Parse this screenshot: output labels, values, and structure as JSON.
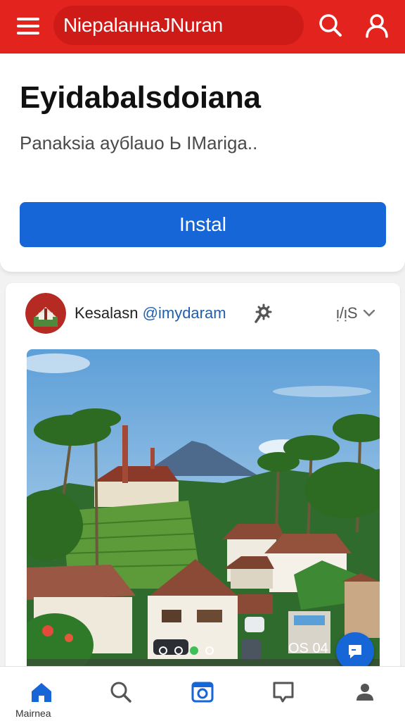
{
  "topbar": {
    "title": "NiepalaннaJNuran",
    "menu_icon": "hamburger-menu-icon",
    "search_icon": "search-icon",
    "profile_icon": "user-icon",
    "color": "#e3231e"
  },
  "header": {
    "title": "Eyidabalsdoiana",
    "subtitle": "Panaksia ayбlauo Ь IMariga..",
    "install_label": "Instal",
    "install_color": "#1666d8"
  },
  "post": {
    "author": "Kesalasn",
    "handle": "@imydaram",
    "more_label": "ᴉ/ᴉS",
    "photo_counter": "OS 04",
    "dots": 4,
    "active_dot": 2
  },
  "bottom_nav": {
    "items": [
      {
        "icon": "home-icon",
        "label": "Mairnea",
        "active": true
      },
      {
        "icon": "search-icon"
      },
      {
        "icon": "camera-icon"
      },
      {
        "icon": "message-icon"
      },
      {
        "icon": "profile-icon"
      }
    ],
    "active_color": "#1666d8"
  }
}
